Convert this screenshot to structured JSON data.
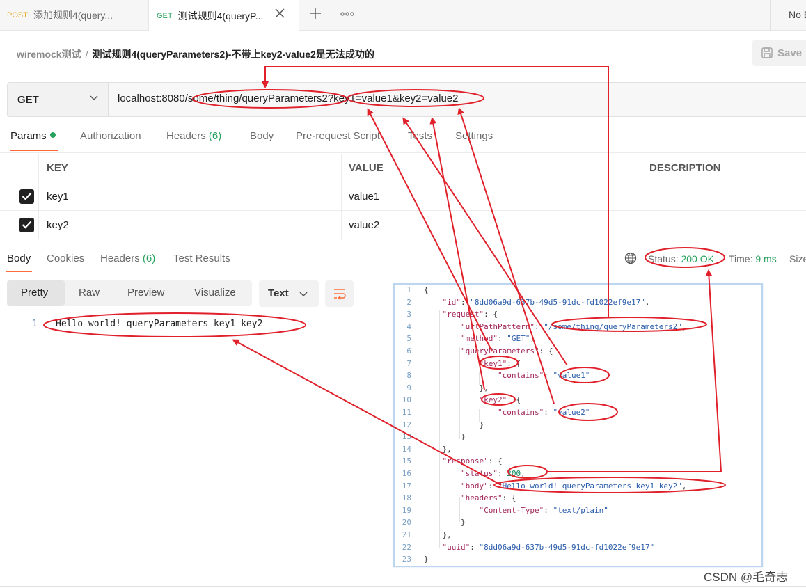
{
  "tabs": [
    {
      "method": "POST",
      "label": "添加规则4(query..."
    },
    {
      "method": "GET",
      "label": "测试规则4(queryP..."
    }
  ],
  "env_label": "No E",
  "breadcrumb": {
    "collection": "wiremock测试",
    "separator": "/",
    "title": "测试规则4(queryParameters2)-不带上key2-value2是无法成功的"
  },
  "save_label": "Save",
  "request": {
    "method": "GET",
    "url": "localhost:8080/some/thing/queryParameters2?key1=value1&key2=value2"
  },
  "request_tabs": [
    {
      "label": "Params",
      "count": ""
    },
    {
      "label": "Authorization",
      "count": ""
    },
    {
      "label": "Headers",
      "count": "(6)"
    },
    {
      "label": "Body",
      "count": ""
    },
    {
      "label": "Pre-request Script",
      "count": ""
    },
    {
      "label": "Tests",
      "count": ""
    },
    {
      "label": "Settings",
      "count": ""
    }
  ],
  "params_table": {
    "headers": [
      "KEY",
      "VALUE",
      "DESCRIPTION"
    ],
    "rows": [
      {
        "checked": true,
        "key": "key1",
        "value": "value1",
        "description": ""
      },
      {
        "checked": true,
        "key": "key2",
        "value": "value2",
        "description": ""
      }
    ]
  },
  "response_tabs": [
    {
      "label": "Body",
      "count": ""
    },
    {
      "label": "Cookies",
      "count": ""
    },
    {
      "label": "Headers",
      "count": "(6)"
    },
    {
      "label": "Test Results",
      "count": ""
    }
  ],
  "response_status": {
    "status_label": "Status:",
    "status_value": "200 OK",
    "time_label": "Time:",
    "time_value": "9 ms",
    "size_label": "Size"
  },
  "view_modes": [
    "Pretty",
    "Raw",
    "Preview",
    "Visualize"
  ],
  "format_select": "Text",
  "response_body": {
    "line_number": "1",
    "text": "Hello world! queryParameters key1 key2"
  },
  "code_lines": [
    "{",
    "    \"id\": \"8dd06a9d-637b-49d5-91dc-fd1022ef9e17\",",
    "    \"request\": {",
    "        \"urlPathPattern\": \"/some/thing/queryParameters2\",",
    "        \"method\": \"GET\",",
    "        \"queryParameters\": {",
    "            \"key1\": {",
    "                \"contains\": \"value1\"",
    "            },",
    "            \"key2\": {",
    "                \"contains\": \"value2\"",
    "            }",
    "        }",
    "    },",
    "    \"response\": {",
    "        \"status\": 200,",
    "        \"body\": \"Hello world! queryParameters key1 key2\",",
    "        \"headers\": {",
    "            \"Content-Type\": \"text/plain\"",
    "        }",
    "    },",
    "    \"uuid\": \"8dd06a9d-637b-49d5-91dc-fd1022ef9e17\"",
    "}"
  ],
  "watermark": "CSDN @毛奇志",
  "colors": {
    "accent": "#ff6c37",
    "success": "#26a35c",
    "annotation": "#e0202a",
    "post": "#e8a21a"
  }
}
